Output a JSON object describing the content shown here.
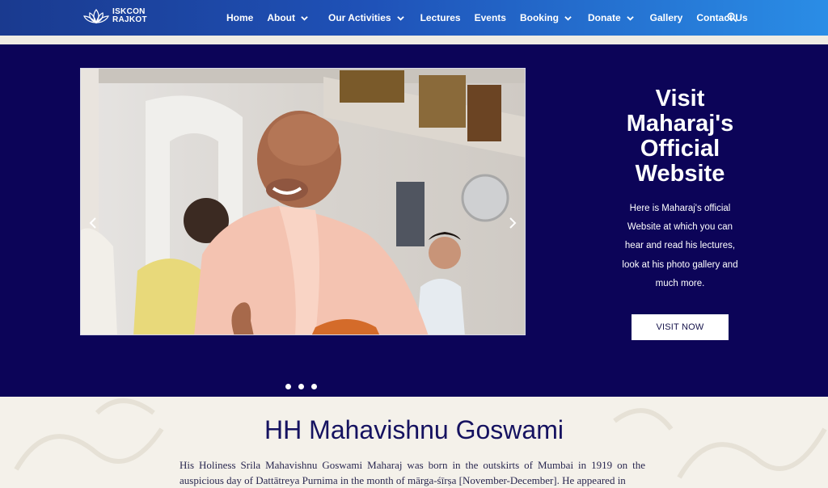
{
  "header": {
    "logo_line1": "ISKCON",
    "logo_line2": "RAJKOT",
    "nav": [
      {
        "label": "Home",
        "dropdown": false
      },
      {
        "label": "About",
        "dropdown": true
      },
      {
        "label": "Our Activities",
        "dropdown": true
      },
      {
        "label": "Lectures",
        "dropdown": false
      },
      {
        "label": "Events",
        "dropdown": false
      },
      {
        "label": "Booking",
        "dropdown": true
      },
      {
        "label": "Donate",
        "dropdown": true
      },
      {
        "label": "Gallery",
        "dropdown": false
      },
      {
        "label": "Contact Us",
        "dropdown": false
      }
    ],
    "search_icon": "search-icon"
  },
  "hero": {
    "title": "Visit Maharaj's Official Website",
    "text": "Here is Maharaj's official Website at which you can hear and read his lectures, look at his photo gallery and much more.",
    "button_label": "VISIT NOW",
    "slide_count": 3
  },
  "bio": {
    "title": "HH Mahavishnu Goswami",
    "text": "His Holiness Srila Mahavishnu Goswami Maharaj was born in the outskirts of Mumbai in 1919 on the auspicious day of Dattātreya Purnima in the month of mārga-śīrṣa [November-December]. He appeared in"
  },
  "colors": {
    "header_start": "#1a3a8f",
    "header_end": "#2a8de6",
    "hero_bg": "#0c0458",
    "title_color": "#151260",
    "page_bg": "#f4f1ea"
  }
}
